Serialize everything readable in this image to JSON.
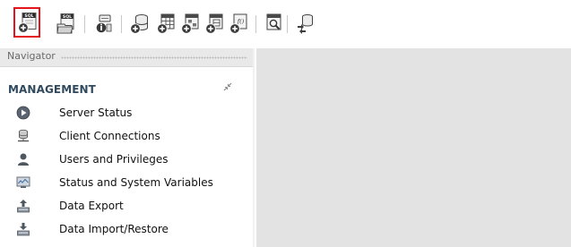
{
  "toolbar": {
    "buttons": [
      {
        "name": "new-sql-tab",
        "icon": "sql-new-icon",
        "glyph_text": "SQL",
        "selected": true
      },
      {
        "name": "open-sql-script",
        "icon": "sql-open-icon",
        "glyph_text": "SQL"
      },
      {
        "name": "open-inspector",
        "icon": "inspector-icon"
      },
      {
        "name": "create-schema",
        "icon": "database-add-icon"
      },
      {
        "name": "create-table",
        "icon": "table-add-icon"
      },
      {
        "name": "create-view",
        "icon": "view-add-icon"
      },
      {
        "name": "create-stored-procedure",
        "icon": "procedure-add-icon"
      },
      {
        "name": "create-function",
        "icon": "function-add-icon",
        "glyph_text": "f()"
      },
      {
        "name": "search-table-data",
        "icon": "search-data-icon"
      },
      {
        "name": "reconnect-to-dbms",
        "icon": "reconnect-icon"
      }
    ],
    "selected_highlight_color": "#e3141b"
  },
  "navigator": {
    "title": "Navigator",
    "section_title": "MANAGEMENT",
    "items": [
      {
        "label": "Server Status",
        "icon": "play-circle-icon"
      },
      {
        "label": "Client Connections",
        "icon": "connections-icon"
      },
      {
        "label": "Users and Privileges",
        "icon": "user-icon"
      },
      {
        "label": "Status and System Variables",
        "icon": "monitor-icon"
      },
      {
        "label": "Data Export",
        "icon": "export-icon"
      },
      {
        "label": "Data Import/Restore",
        "icon": "import-icon"
      }
    ]
  },
  "colors": {
    "section_title": "#2f4a5f",
    "workspace_bg": "#e3e3e3",
    "nav_header_bg": "#e9e9e9"
  }
}
